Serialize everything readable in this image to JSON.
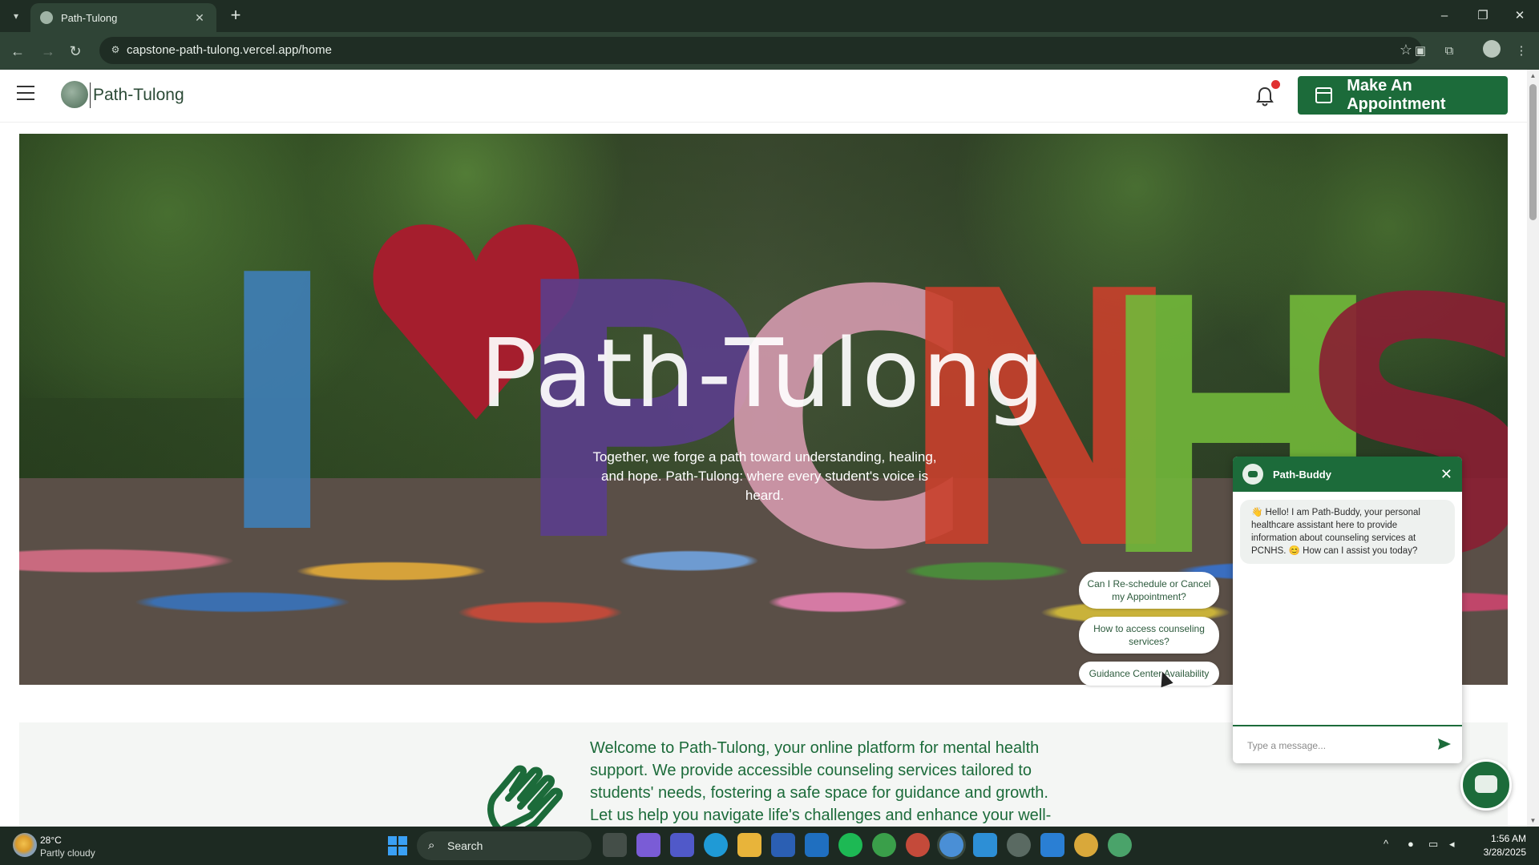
{
  "browser": {
    "tab_title": "Path-Tulong",
    "url": "capstone-path-tulong.vercel.app/home"
  },
  "header": {
    "brand": "Path-Tulong",
    "appointment_label": "Make An Appointment"
  },
  "hero": {
    "title": "Path-Tulong",
    "subtitle": "Together, we forge a path toward understanding, healing, and hope. Path-Tulong: where every student's voice is heard."
  },
  "welcome": {
    "text": "Welcome to Path-Tulong, your online platform for mental health support. We provide accessible counseling services tailored to students' needs, fostering a safe space for guidance and growth. Let us help you navigate life's challenges and enhance your well-"
  },
  "chat": {
    "title": "Path-Buddy",
    "bot_message": "👋 Hello! I am Path-Buddy, your personal healthcare assistant here to provide information about counseling services at PCNHS. 😊 How can I assist you today?",
    "input_placeholder": "Type a message...",
    "suggestions": [
      "Can I Re-schedule or Cancel my Appointment?",
      "How to access counseling services?",
      "Guidance Center Availability"
    ]
  },
  "taskbar": {
    "temperature": "28°C",
    "condition": "Partly cloudy",
    "search_label": "Search",
    "time": "1:56 AM",
    "date": "3/28/2025"
  },
  "colors": {
    "brand_green": "#1c6b3a",
    "notification_red": "#e03131"
  }
}
